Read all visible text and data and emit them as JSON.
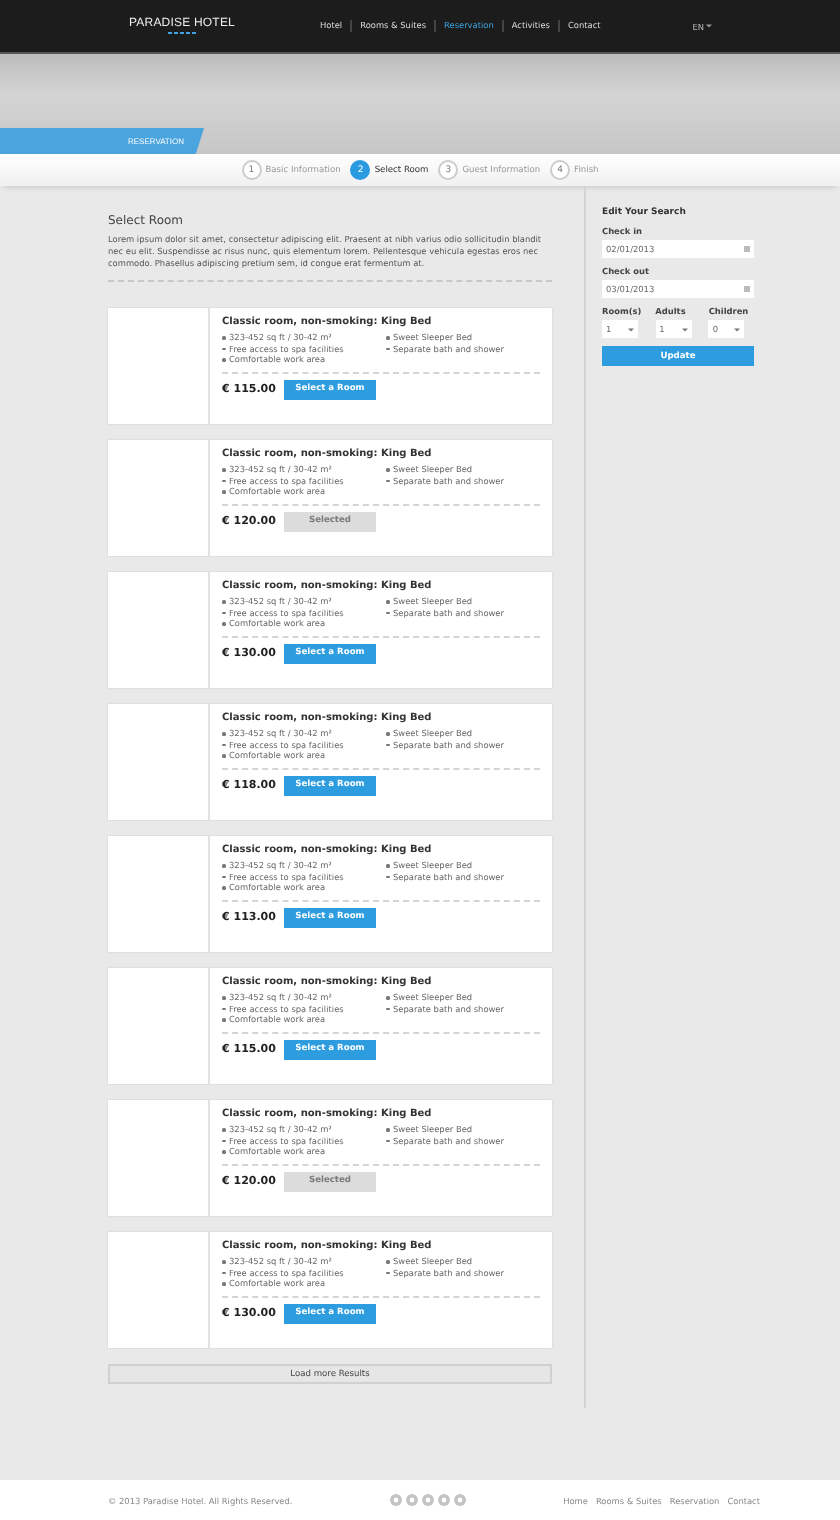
{
  "header": {
    "logo": "PARADISE HOTEL",
    "nav": [
      {
        "label": "Hotel",
        "selected": false
      },
      {
        "label": "Rooms & Suites",
        "selected": false
      },
      {
        "label": "Reservation",
        "selected": true
      },
      {
        "label": "Activities",
        "selected": false
      },
      {
        "label": "Contact",
        "selected": false
      }
    ],
    "language": "EN"
  },
  "hero": {
    "tab": "RESERVATION"
  },
  "steps": [
    {
      "number": "1",
      "label": "Basic Information",
      "selected": false
    },
    {
      "number": "2",
      "label": "Select Room",
      "selected": true
    },
    {
      "number": "3",
      "label": "Guest Information",
      "selected": false
    },
    {
      "number": "4",
      "label": "Finish",
      "selected": false
    }
  ],
  "intro": {
    "title": "Select Room",
    "text": "Lorem ipsum dolor sit amet, consectetur adipiscing elit. Praesent at nibh varius odio sollicitudin blandit nec eu elit. Suspendisse ac risus nunc, quis elementum lorem. Pellentesque vehicula egestas eros nec commodo. Phasellus adipiscing pretium sem, id congue erat fermentum at."
  },
  "rooms": [
    {
      "kind": "picture",
      "title": "Classic room, non-smoking: King Bed",
      "features": [
        "323-452 sq ft / 30-42 m²",
        "Sweet Sleeper Bed",
        "Free access to spa facilities",
        "Separate bath and shower",
        "Comfortable work area"
      ],
      "price": "€ 115.00",
      "button": "Select a Room",
      "selected": false
    },
    {
      "kind": "picture",
      "title": "Classic room, non-smoking: King Bed",
      "features": [
        "323-452 sq ft / 30-42 m²",
        "Sweet Sleeper Bed",
        "Free access to spa facilities",
        "Separate bath and shower",
        "Comfortable work area"
      ],
      "price": "€ 120.00",
      "button": "Selected",
      "selected": true
    },
    {
      "kind": "picture",
      "title": "Classic room, non-smoking: King Bed",
      "features": [
        "323-452 sq ft / 30-42 m²",
        "Sweet Sleeper Bed",
        "Free access to spa facilities",
        "Separate bath and shower",
        "Comfortable work area"
      ],
      "price": "€ 130.00",
      "button": "Select a Room",
      "selected": false
    },
    {
      "kind": "picture",
      "title": "Classic room, non-smoking: King Bed",
      "features": [
        "323-452 sq ft / 30-42 m²",
        "Sweet Sleeper Bed",
        "Free access to spa facilities",
        "Separate bath and shower",
        "Comfortable work area"
      ],
      "price": "€ 118.00",
      "button": "Select a Room",
      "selected": false
    },
    {
      "kind": "picture",
      "title": "Classic room, non-smoking: King Bed",
      "features": [
        "323-452 sq ft / 30-42 m²",
        "Sweet Sleeper Bed",
        "Free access to spa facilities",
        "Separate bath and shower",
        "Comfortable work area"
      ],
      "price": "€ 113.00",
      "button": "Select a Room",
      "selected": false
    },
    {
      "kind": "picture",
      "title": "Classic room, non-smoking: King Bed",
      "features": [
        "323-452 sq ft / 30-42 m²",
        "Sweet Sleeper Bed",
        "Free access to spa facilities",
        "Separate bath and shower",
        "Comfortable work area"
      ],
      "price": "€ 115.00",
      "button": "Select a Room",
      "selected": false
    },
    {
      "kind": "picture",
      "title": "Classic room, non-smoking: King Bed",
      "features": [
        "323-452 sq ft / 30-42 m²",
        "Sweet Sleeper Bed",
        "Free access to spa facilities",
        "Separate bath and shower",
        "Comfortable work area"
      ],
      "price": "€ 120.00",
      "button": "Selected",
      "selected": true
    },
    {
      "kind": "picture",
      "title": "Classic room, non-smoking: King Bed",
      "features": [
        "323-452 sq ft / 30-42 m²",
        "Sweet Sleeper Bed",
        "Free access to spa facilities",
        "Separate bath and shower",
        "Comfortable work area"
      ],
      "price": "€ 130.00",
      "button": "Select a Room",
      "selected": false
    }
  ],
  "load_more": "Load more Results",
  "sidebar": {
    "title": "Edit Your Search",
    "check_in": {
      "label": "Check in",
      "value": "02/01/2013"
    },
    "check_out": {
      "label": "Check out",
      "value": "03/01/2013"
    },
    "selects": [
      {
        "label": "Room(s)",
        "value": "1"
      },
      {
        "label": "Adults",
        "value": "1"
      },
      {
        "label": "Children",
        "value": "0"
      }
    ],
    "button": "Update"
  },
  "footer": {
    "copyright": "© 2013 Paradise Hotel. All Rights Reserved.",
    "links": [
      "Home",
      "Rooms & Suites",
      "Reservation",
      "Contact"
    ]
  }
}
